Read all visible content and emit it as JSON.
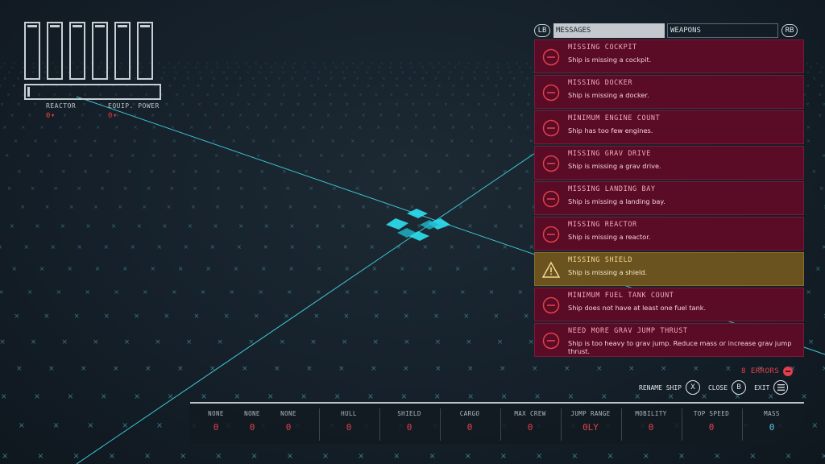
{
  "gauges": {
    "reactor_label": "REACTOR",
    "reactor_value": "0▾",
    "equip_label": "EQUIP. POWER",
    "equip_value": "0▾"
  },
  "tabs": {
    "left_button": "LB",
    "right_button": "RB",
    "items": [
      {
        "label": "MESSAGES",
        "active": true
      },
      {
        "label": "WEAPONS",
        "active": false
      }
    ]
  },
  "messages": [
    {
      "title": "MISSING COCKPIT",
      "desc": "Ship is missing a cockpit.",
      "type": "error"
    },
    {
      "title": "MISSING DOCKER",
      "desc": "Ship is missing a docker.",
      "type": "error"
    },
    {
      "title": "MINIMUM ENGINE COUNT",
      "desc": "Ship has too few engines.",
      "type": "error"
    },
    {
      "title": "MISSING GRAV DRIVE",
      "desc": "Ship is missing a grav drive.",
      "type": "error"
    },
    {
      "title": "MISSING LANDING BAY",
      "desc": "Ship is missing a landing bay.",
      "type": "error"
    },
    {
      "title": "MISSING REACTOR",
      "desc": "Ship is missing a reactor.",
      "type": "error"
    },
    {
      "title": "MISSING SHIELD",
      "desc": "Ship is missing a shield.",
      "type": "warning"
    },
    {
      "title": "MINIMUM FUEL TANK COUNT",
      "desc": "Ship does not have at least one fuel tank.",
      "type": "error"
    },
    {
      "title": "NEED MORE GRAV JUMP THRUST",
      "desc": "Ship is too heavy to grav jump. Reduce mass or increase grav jump thrust.",
      "type": "error"
    }
  ],
  "errors_label": "8 ERRORS",
  "actions": {
    "rename_label": "RENAME SHIP",
    "rename_key": "X",
    "close_label": "CLOSE",
    "close_key": "B",
    "exit_label": "EXIT"
  },
  "stats": [
    {
      "label": "NONE",
      "value": "0"
    },
    {
      "label": "NONE",
      "value": "0"
    },
    {
      "label": "NONE",
      "value": "0"
    },
    {
      "label": "HULL",
      "value": "0"
    },
    {
      "label": "SHIELD",
      "value": "0"
    },
    {
      "label": "CARGO",
      "value": "0"
    },
    {
      "label": "MAX CREW",
      "value": "0"
    },
    {
      "label": "JUMP RANGE",
      "value": "0LY"
    },
    {
      "label": "MOBILITY",
      "value": "0"
    },
    {
      "label": "TOP SPEED",
      "value": "0"
    },
    {
      "label": "MASS",
      "value": "0"
    }
  ],
  "colors": {
    "error_bg": "#5a0b25",
    "warning_bg": "#6b531f",
    "error_red": "#e2404a",
    "mass_blue": "#5bc8e6",
    "grid_line": "#3fd0e0"
  }
}
